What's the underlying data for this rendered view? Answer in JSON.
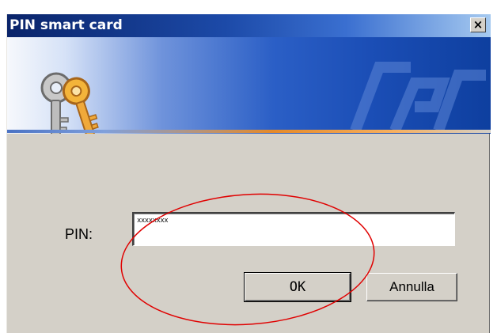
{
  "window": {
    "title": "PIN smart card",
    "close_glyph": "×"
  },
  "form": {
    "pin_label": "PIN:",
    "pin_value": "xxxxxxxx"
  },
  "buttons": {
    "ok_label": "OK",
    "cancel_label": "Annulla"
  },
  "colors": {
    "titlebar_start": "#0a246a",
    "dialog_bg": "#d4d0c8",
    "annotation_ring": "#e00000"
  },
  "icons": [
    "keys-icon",
    "close-icon"
  ]
}
